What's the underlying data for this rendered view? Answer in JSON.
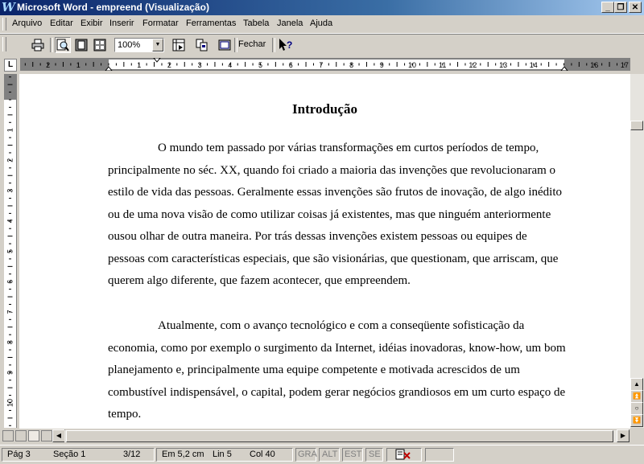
{
  "window": {
    "app_icon": "W",
    "title": "Microsoft Word - empreend (Visualização)",
    "controls": [
      "minimize",
      "restore",
      "close"
    ]
  },
  "menubar": {
    "items": [
      "Arquivo",
      "Editar",
      "Exibir",
      "Inserir",
      "Formatar",
      "Ferramentas",
      "Tabela",
      "Janela",
      "Ajuda"
    ]
  },
  "toolbar": {
    "zoom_value": "100%",
    "close_label": "Fechar",
    "icons": [
      "print-icon",
      "magnifier-icon",
      "one-page-icon",
      "multiple-pages-icon",
      "view-ruler-icon",
      "shrink-to-fit-icon",
      "full-screen-icon",
      "context-help-icon"
    ]
  },
  "ruler": {
    "corner": "L",
    "h_labels": [
      "2",
      "1",
      "1",
      "2",
      "3",
      "4",
      "5",
      "6",
      "7",
      "8",
      "9",
      "10",
      "11",
      "12",
      "13",
      "14",
      "16",
      "17"
    ],
    "v_labels": [
      "1",
      "1",
      "2",
      "3",
      "4",
      "5",
      "6",
      "7",
      "8",
      "9",
      "10",
      "11"
    ]
  },
  "document": {
    "heading": "Introdução",
    "paragraph1": "O mundo tem passado por várias transformações em curtos períodos de tempo, principalmente no séc. XX, quando foi criado a maioria das invenções que revolucionaram o estilo de vida das pessoas. Geralmente essas invenções são frutos de inovação, de algo inédito ou de uma nova visão de como utilizar coisas já existentes, mas que ninguém anteriormente ousou olhar de outra maneira. Por trás dessas invenções existem pessoas ou equipes de pessoas com características especiais, que são visionárias, que questionam, que arriscam, que querem algo diferente, que fazem acontecer, que empreendem.",
    "paragraph2": "Atualmente, com o avanço tecnológico e com a conseqüente sofisticação da economia, como por exemplo o surgimento da Internet, idéias inovadoras, know-how, um bom planejamento e, principalmente uma equipe competente e motivada acrescidos de um combustível indispensável, o capital, podem gerar negócios grandiosos em um curto espaço de tempo."
  },
  "status": {
    "page": "Pág 3",
    "section": "Seção 1",
    "pages": "3/12",
    "position": "Em 5,2 cm",
    "line": "Lin 5",
    "column": "Col 40",
    "modes": [
      "GRA",
      "ALT",
      "EST",
      "SE"
    ]
  }
}
